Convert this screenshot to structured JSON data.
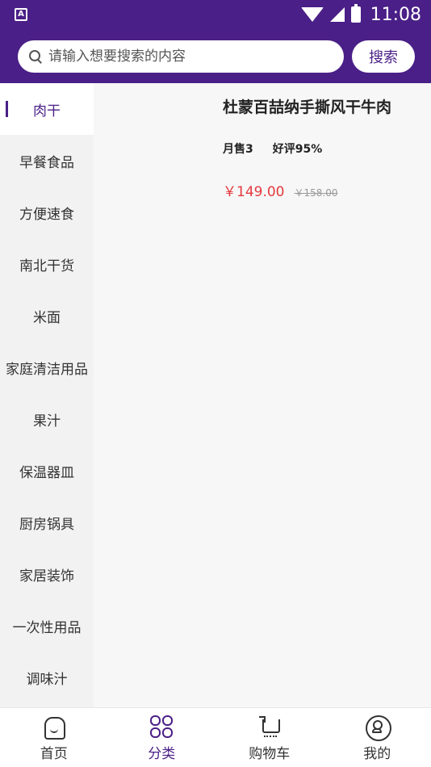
{
  "status_bar": {
    "left_icon": "A",
    "time": "11:08",
    "icons": [
      "wifi-icon",
      "signal-icon",
      "battery-icon"
    ]
  },
  "search": {
    "placeholder": "请输入想要搜索的内容",
    "button_label": "搜索"
  },
  "sidebar": {
    "items": [
      {
        "label": "肉干",
        "active": true
      },
      {
        "label": "早餐食品"
      },
      {
        "label": "方便速食"
      },
      {
        "label": "南北干货"
      },
      {
        "label": "米面"
      },
      {
        "label": "家庭清洁用品"
      },
      {
        "label": "果汁"
      },
      {
        "label": "保温器皿"
      },
      {
        "label": "厨房锅具"
      },
      {
        "label": "家居装饰"
      },
      {
        "label": "一次性用品"
      },
      {
        "label": "调味汁"
      }
    ]
  },
  "product": {
    "title": "杜蒙百喆纳手撕风干牛肉",
    "monthly_sales": "月售3",
    "rating": "好评95%",
    "price": "￥149.00",
    "original_price": "￥158.00"
  },
  "tabbar": {
    "tabs": [
      {
        "label": "首页",
        "icon": "home-icon"
      },
      {
        "label": "分类",
        "icon": "category-icon",
        "active": true
      },
      {
        "label": "购物车",
        "icon": "cart-icon"
      },
      {
        "label": "我的",
        "icon": "profile-icon"
      }
    ]
  },
  "colors": {
    "brand": "#4a1f87",
    "price": "#e4393c"
  }
}
